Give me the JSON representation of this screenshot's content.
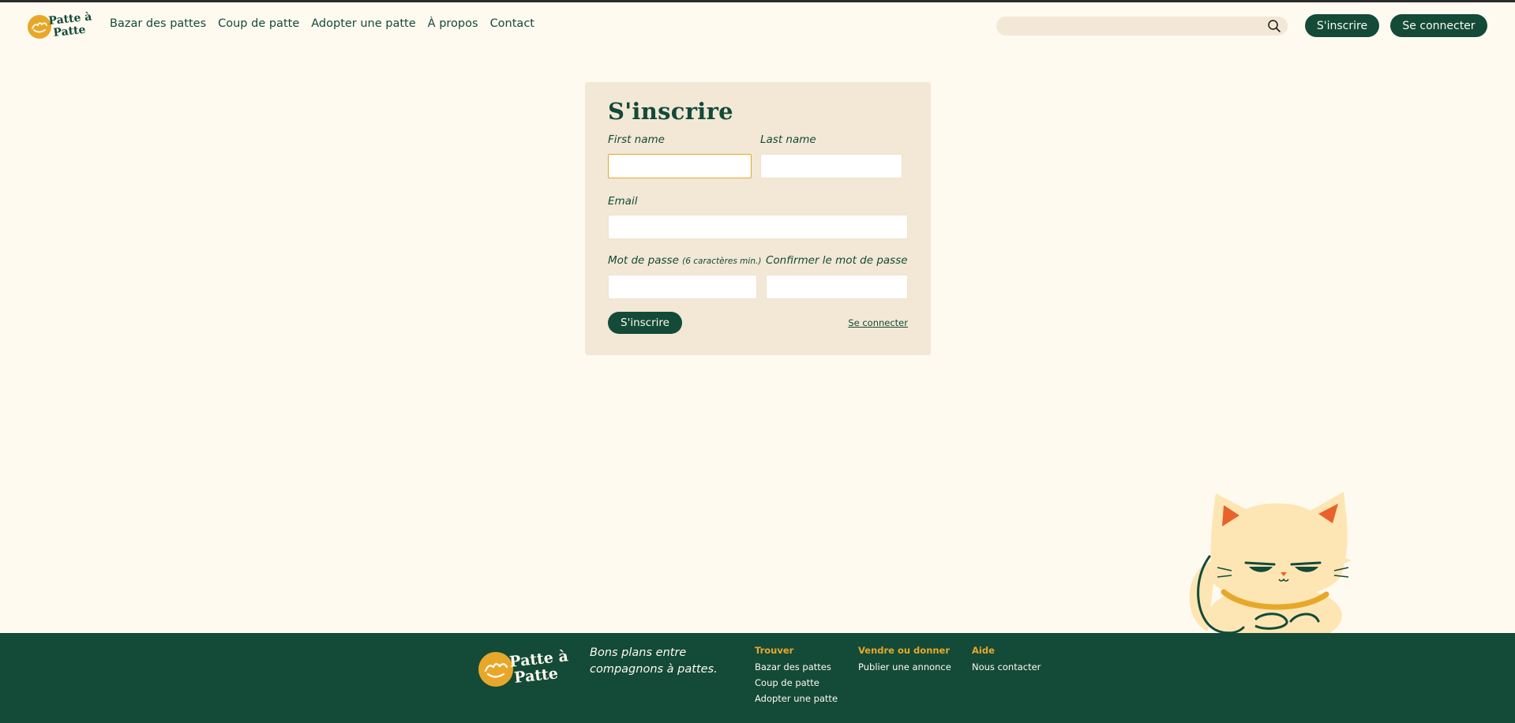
{
  "header": {
    "logo_text": "Patte à Patte",
    "nav": [
      "Bazar des pattes",
      "Coup de patte",
      "Adopter une patte",
      "À propos",
      "Contact"
    ],
    "search": {
      "placeholder": "",
      "icon": "search-icon"
    },
    "signup_label": "S'inscrire",
    "login_label": "Se connecter"
  },
  "form": {
    "title": "S'inscrire",
    "first_name_label": "First name",
    "last_name_label": "Last name",
    "email_label": "Email",
    "password_label": "Mot de passe",
    "password_hint": "(6 caractères min.)",
    "confirm_label": "Confirmer le mot de passe",
    "first_name_value": "",
    "last_name_value": "",
    "email_value": "",
    "password_value": "",
    "confirm_value": "",
    "submit_label": "S'inscrire",
    "login_link": "Se connecter"
  },
  "footer": {
    "logo_text": "Patte à Patte",
    "tagline": "Bons plans entre compagnons à pattes.",
    "columns": [
      {
        "title": "Trouver",
        "links": [
          "Bazar des pattes",
          "Coup de patte",
          "Adopter une patte"
        ]
      },
      {
        "title": "Vendre ou donner",
        "links": [
          "Publier une annonce"
        ]
      },
      {
        "title": "Aide",
        "links": [
          "Nous contacter"
        ]
      }
    ]
  },
  "colors": {
    "brand_green": "#134a38",
    "accent_yellow": "#e7a82a",
    "background": "#fffaf0",
    "card": "#f2e8d5"
  }
}
